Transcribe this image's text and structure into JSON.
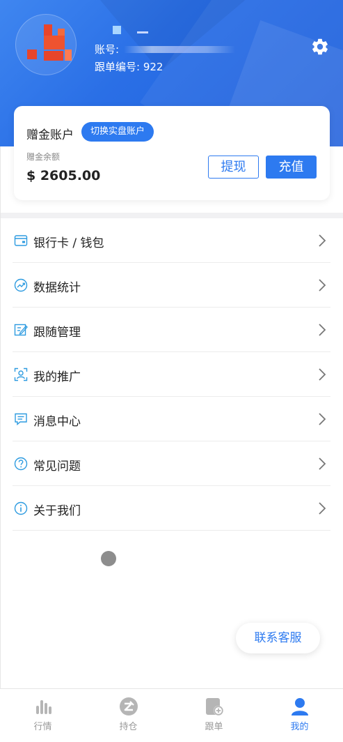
{
  "header": {
    "account_label": "账号:",
    "follow_id_label": "跟单编号:",
    "follow_id_value": "922",
    "icons": {
      "settings": "gear-icon",
      "avatar": "avatar"
    }
  },
  "account_card": {
    "title": "赠金账户",
    "switch_label": "切换实盘账户",
    "balance_label": "赠金余额",
    "balance_value": "$ 2605.00",
    "withdraw_label": "提现",
    "recharge_label": "充值"
  },
  "menu": [
    {
      "label": "银行卡 / 钱包",
      "icon": "wallet-icon"
    },
    {
      "label": "数据统计",
      "icon": "trend-icon"
    },
    {
      "label": "跟随管理",
      "icon": "edit-icon"
    },
    {
      "label": "我的推广",
      "icon": "user-frame-icon"
    },
    {
      "label": "消息中心",
      "icon": "message-icon"
    },
    {
      "label": "常见问题",
      "icon": "question-icon"
    },
    {
      "label": "关于我们",
      "icon": "info-icon"
    }
  ],
  "contact_label": "联系客服",
  "tabbar": [
    {
      "label": "行情",
      "icon": "chart-bars-icon",
      "active": false
    },
    {
      "label": "持仓",
      "icon": "position-icon",
      "active": false
    },
    {
      "label": "跟单",
      "icon": "follow-add-icon",
      "active": false
    },
    {
      "label": "我的",
      "icon": "user-icon",
      "active": true
    }
  ],
  "colors": {
    "accent": "#2d7af0",
    "hero": "#2a6fe6",
    "inactive": "#999999"
  }
}
